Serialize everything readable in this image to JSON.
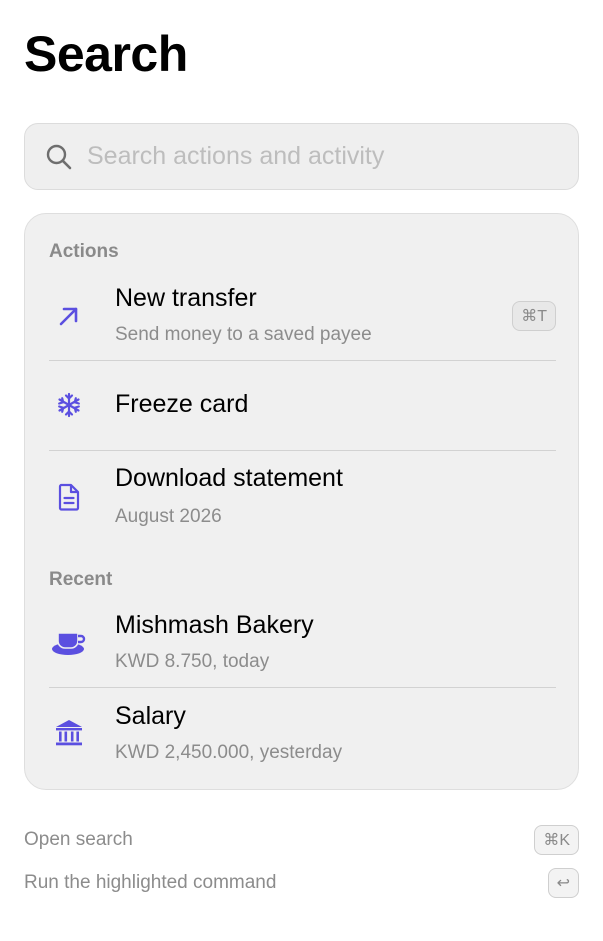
{
  "page": {
    "title": "Search"
  },
  "search": {
    "placeholder": "Search actions and activity",
    "value": ""
  },
  "sections": {
    "actions": {
      "header": "Actions",
      "items": [
        {
          "title": "New transfer",
          "subtitle": "Send money to a saved payee",
          "shortcut": "⌘T",
          "icon": "arrow-up-right-icon"
        },
        {
          "title": "Freeze card",
          "icon": "snowflake-icon"
        },
        {
          "title": "Download statement",
          "subtitle": "August 2026",
          "icon": "document-icon"
        }
      ]
    },
    "recent": {
      "header": "Recent",
      "items": [
        {
          "title": "Mishmash Bakery",
          "subtitle": "KWD 8.750, today",
          "icon": "coffee-cup-icon"
        },
        {
          "title": "Salary",
          "subtitle": "KWD 2,450.000, yesterday",
          "icon": "bank-icon"
        }
      ]
    }
  },
  "footer": {
    "hints": [
      {
        "label": "Open search",
        "key": "⌘K"
      },
      {
        "label": "Run the highlighted command",
        "key": "↩"
      }
    ]
  },
  "colors": {
    "accent": "#5b4fe0",
    "panel_bg": "#f0f0f0",
    "muted_text": "#8c8c8c"
  }
}
